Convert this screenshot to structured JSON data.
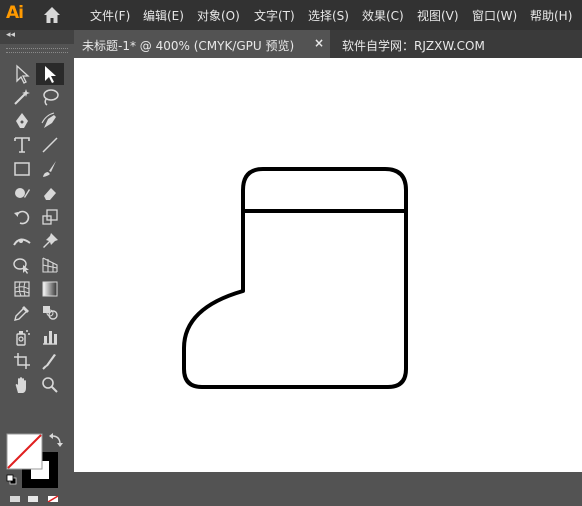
{
  "app": {
    "logo": "Ai"
  },
  "menu": [
    {
      "label": "文件(F)"
    },
    {
      "label": "编辑(E)"
    },
    {
      "label": "对象(O)"
    },
    {
      "label": "文字(T)"
    },
    {
      "label": "选择(S)"
    },
    {
      "label": "效果(C)"
    },
    {
      "label": "视图(V)"
    },
    {
      "label": "窗口(W)"
    },
    {
      "label": "帮助(H)"
    }
  ],
  "toolbar": {
    "collapse": "◂◂"
  },
  "tabs": [
    {
      "label": "未标题-1* @ 400% (CMYK/GPU 预览)",
      "close": "×"
    },
    {
      "label": "软件自学网：RJZXW.COM"
    }
  ],
  "tools": [
    "selection-tool",
    "direct-selection-tool",
    "magic-wand-tool",
    "lasso-tool",
    "pen-tool",
    "curvature-tool",
    "type-tool",
    "line-segment-tool",
    "rectangle-tool",
    "paintbrush-tool",
    "shaper-tool",
    "eraser-tool",
    "rotate-tool",
    "scale-tool",
    "width-tool",
    "puppet-warp-tool",
    "shape-builder-tool",
    "perspective-grid-tool",
    "mesh-tool",
    "gradient-tool",
    "eyedropper-tool",
    "blend-tool",
    "symbol-sprayer-tool",
    "column-graph-tool",
    "artboard-tool",
    "slice-tool",
    "hand-tool",
    "zoom-tool"
  ],
  "colors": {
    "accent": "#ff9a00",
    "stroke": "#000000",
    "fill": "none"
  }
}
